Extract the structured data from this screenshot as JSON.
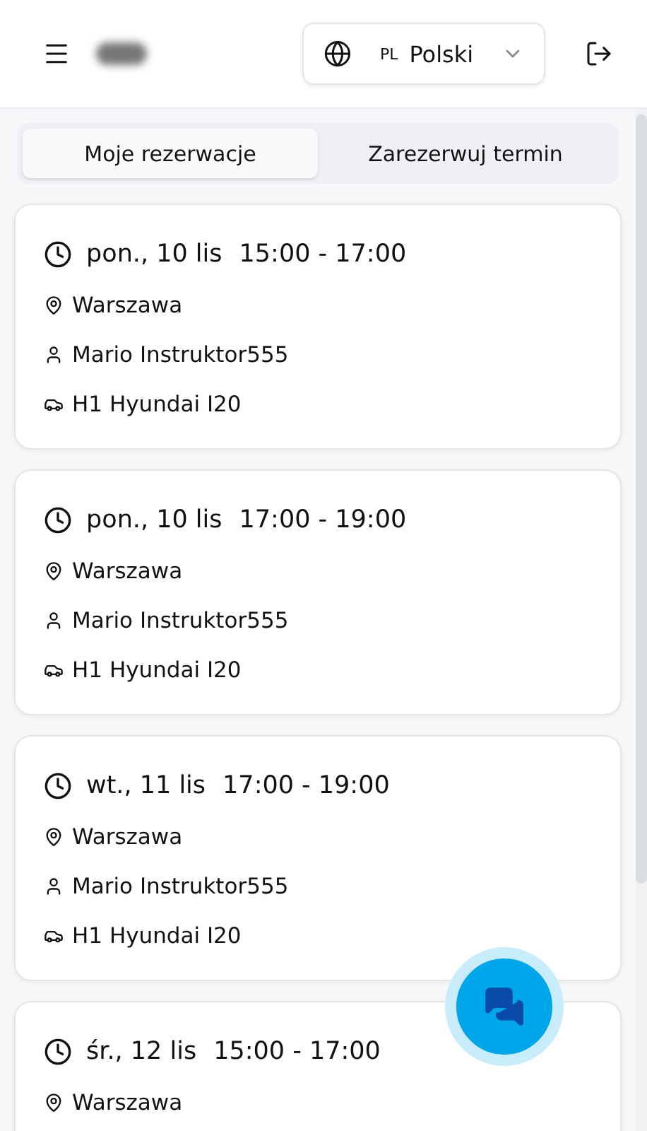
{
  "header": {
    "language": {
      "code": "PL",
      "label": "Polski"
    }
  },
  "tabs": [
    {
      "label": "Moje rezerwacje",
      "selected": true
    },
    {
      "label": "Zarezerwuj termin",
      "selected": false
    }
  ],
  "reservations": [
    {
      "date": "pon., 10 lis",
      "time": "15:00 - 17:00",
      "location": "Warszawa",
      "instructor": "Mario Instruktor555",
      "vehicle": "H1 Hyundai I20"
    },
    {
      "date": "pon., 10 lis",
      "time": "17:00 - 19:00",
      "location": "Warszawa",
      "instructor": "Mario Instruktor555",
      "vehicle": "H1 Hyundai I20"
    },
    {
      "date": "wt., 11 lis",
      "time": "17:00 - 19:00",
      "location": "Warszawa",
      "instructor": "Mario Instruktor555",
      "vehicle": "H1 Hyundai I20"
    },
    {
      "date": "śr., 12 lis",
      "time": "15:00 - 17:00",
      "location": "Warszawa"
    }
  ]
}
